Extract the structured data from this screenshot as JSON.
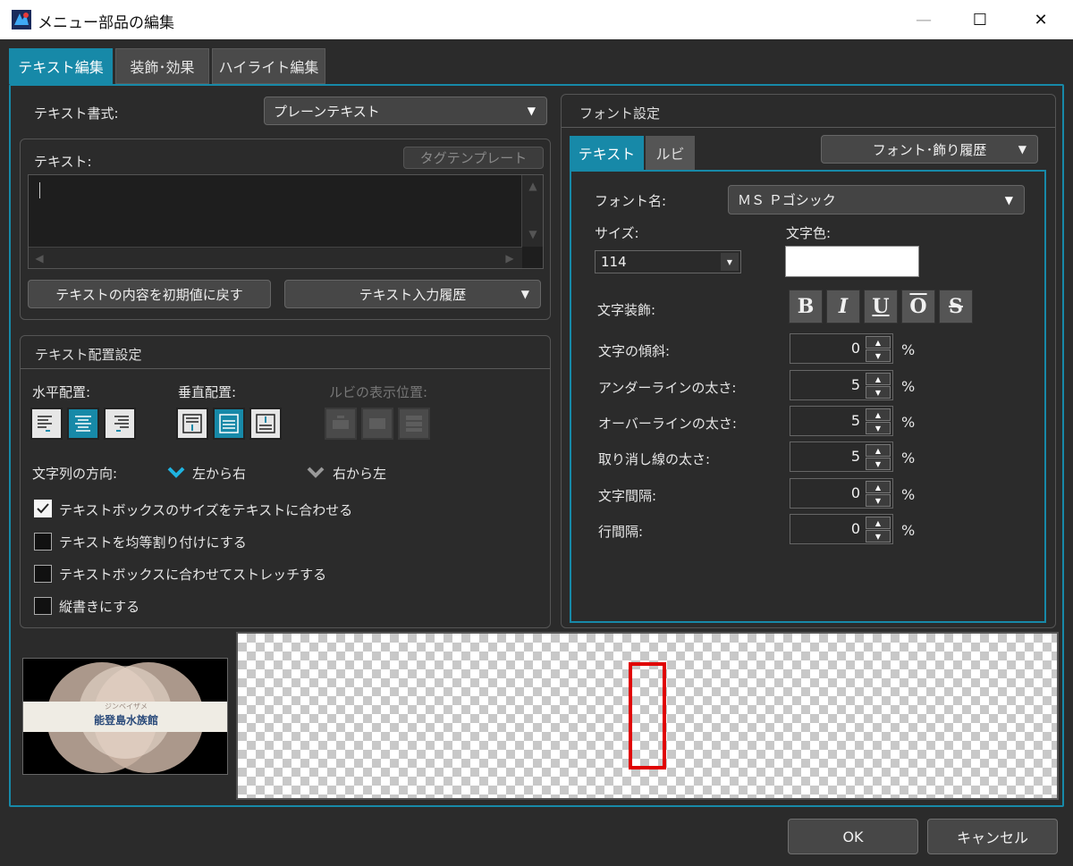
{
  "window": {
    "title": "メニュー部品の編集",
    "minimize": "—",
    "maximize": "☐",
    "close": "✕"
  },
  "tabs": [
    {
      "label": "テキスト編集",
      "active": true
    },
    {
      "label": "装飾･効果",
      "active": false
    },
    {
      "label": "ハイライト編集",
      "active": false
    }
  ],
  "text_panel": {
    "format_label": "テキスト書式:",
    "format_value": "プレーンテキスト",
    "text_label": "テキスト:",
    "tag_template_button": "タグテンプレート",
    "text_value": "",
    "reset_button": "テキストの内容を初期値に戻す",
    "history_button": "テキスト入力履歴"
  },
  "layout_panel": {
    "title": "テキスト配置設定",
    "horizontal_label": "水平配置:",
    "vertical_label": "垂直配置:",
    "ruby_position_label": "ルビの表示位置:",
    "direction_label": "文字列の方向:",
    "direction_ltr": "左から右",
    "direction_rtl": "右から左",
    "checkboxes": [
      {
        "label": "テキストボックスのサイズをテキストに合わせる",
        "checked": true
      },
      {
        "label": "テキストを均等割り付けにする",
        "checked": false
      },
      {
        "label": "テキストボックスに合わせてストレッチする",
        "checked": false
      },
      {
        "label": "縦書きにする",
        "checked": false
      }
    ]
  },
  "font_panel": {
    "title": "フォント設定",
    "tabs": [
      {
        "label": "テキスト",
        "active": true
      },
      {
        "label": "ルビ",
        "active": false
      }
    ],
    "history_button": "フォント･飾り履歴",
    "font_name_label": "フォント名:",
    "font_name_value": "ＭＳ Ｐゴシック",
    "size_label": "サイズ:",
    "size_value": "114",
    "color_label": "文字色:",
    "color_value": "#ffffff",
    "decoration_label": "文字装飾:",
    "decorations": [
      "B",
      "I",
      "U",
      "O",
      "S"
    ],
    "spinners": [
      {
        "label": "文字の傾斜:",
        "value": "0",
        "unit": "%"
      },
      {
        "label": "アンダーラインの太さ:",
        "value": "5",
        "unit": "%"
      },
      {
        "label": "オーバーラインの太さ:",
        "value": "5",
        "unit": "%"
      },
      {
        "label": "取り消し線の太さ:",
        "value": "5",
        "unit": "%"
      },
      {
        "label": "文字間隔:",
        "value": "0",
        "unit": "%"
      },
      {
        "label": "行間隔:",
        "value": "0",
        "unit": "%"
      }
    ]
  },
  "thumbnail": {
    "kana": "ジンベイザメ",
    "title": "能登島水族館"
  },
  "buttons": {
    "ok": "OK",
    "cancel": "キャンセル"
  },
  "colors": {
    "accent": "#1789a8",
    "selection": "#e00000"
  }
}
